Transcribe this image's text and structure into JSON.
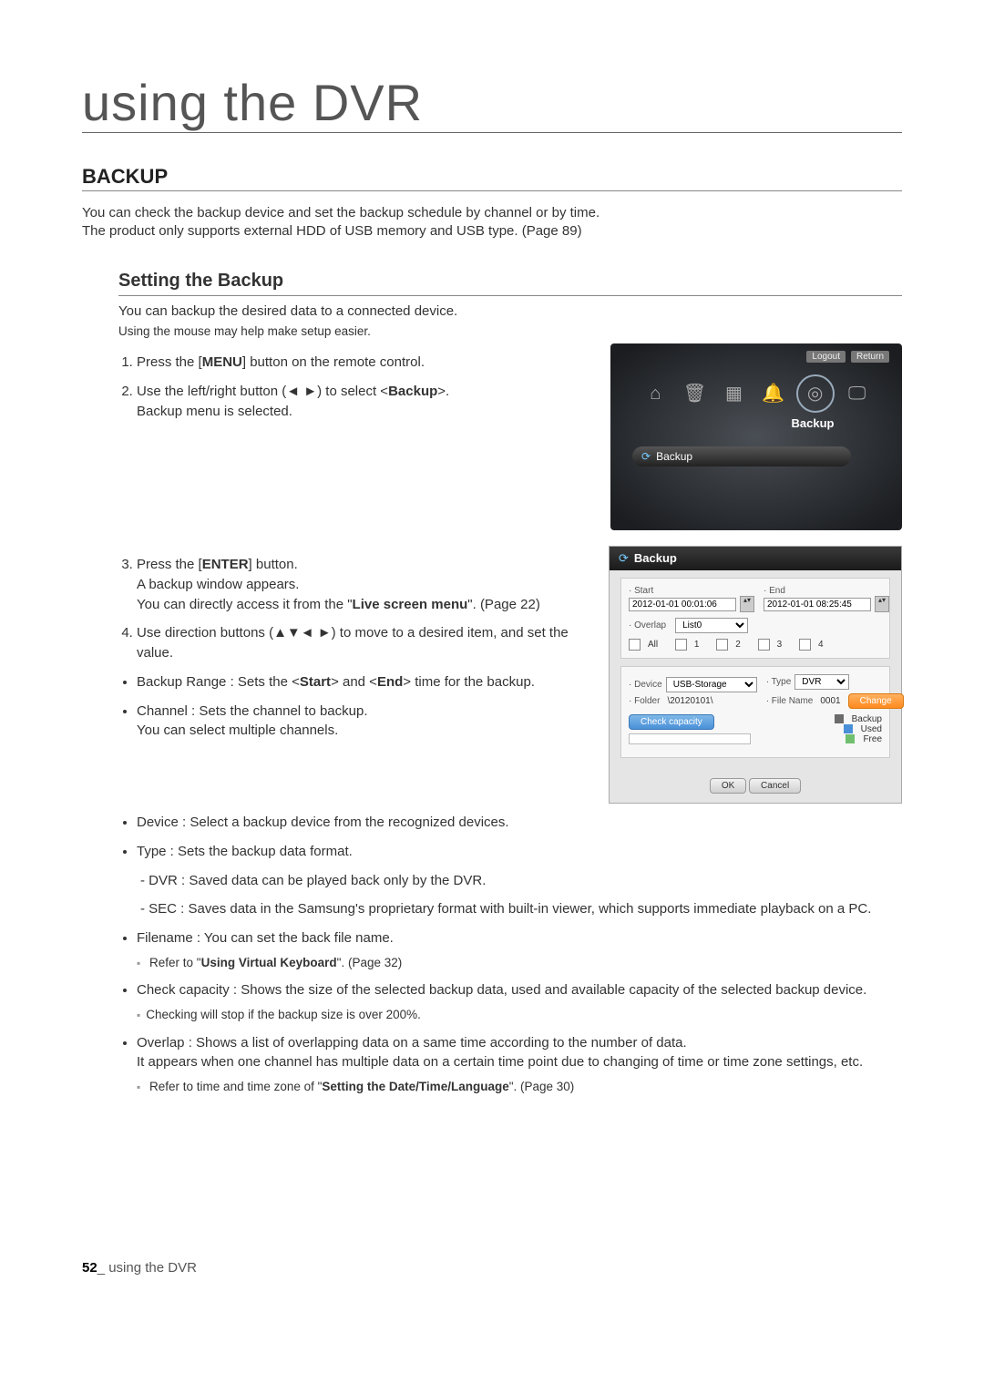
{
  "page_header": "using the DVR",
  "section_title": "BACKUP",
  "intro": {
    "line1": "You can check the backup device and set the backup schedule by channel or by time.",
    "line2": "The product only supports external HDD of USB memory and USB type. (Page 89)"
  },
  "sub_title": "Setting the Backup",
  "lead": "You can backup the desired data to a connected device.",
  "lead_note": "Using the mouse may help make setup easier.",
  "steps12": {
    "s1a": "Press the [",
    "s1b": "MENU",
    "s1c": "] button on the remote control.",
    "s2a": "Use the left/right button (◄ ►) to select <",
    "s2b": "Backup",
    "s2c": ">.",
    "s2d": "Backup menu is selected."
  },
  "fig1": {
    "btn_logout": "Logout",
    "btn_return": "Return",
    "label": "Backup",
    "menuitem": "Backup"
  },
  "steps34": {
    "s3a": "Press the [",
    "s3b": "ENTER",
    "s3c": "] button.",
    "s3d": "A backup window appears.",
    "s3e": "You can directly access it from the \"",
    "s3f": "Live screen menu",
    "s3g": "\". (Page 22)",
    "s4a": "Use direction buttons (▲▼◄ ►) to move to a desired item, and set the value."
  },
  "fig2": {
    "title": "Backup",
    "lbl_start": "· Start",
    "val_start": "2012-01-01 00:01:06",
    "lbl_end": "· End",
    "val_end": "2012-01-01 08:25:45",
    "lbl_overlap": "· Overlap",
    "val_overlap": "List0",
    "chk_all": "All",
    "chk_1": "1",
    "chk_2": "2",
    "chk_3": "3",
    "chk_4": "4",
    "lbl_device": "· Device",
    "val_device": "USB-Storage",
    "lbl_folder": "· Folder",
    "val_folder": "\\20120101\\",
    "lbl_type": "· Type",
    "val_type": "DVR",
    "lbl_filename": "· File Name",
    "val_filename": "0001",
    "btn_change": "Change",
    "btn_check": "Check capacity",
    "leg_backup": "Backup",
    "leg_used": "Used",
    "leg_free": "Free",
    "btn_ok": "OK",
    "btn_cancel": "Cancel"
  },
  "bullets": {
    "b_range_a": "Backup Range : Sets the <",
    "b_range_b": "Start",
    "b_range_c": "> and <",
    "b_range_d": "End",
    "b_range_e": "> time for the backup.",
    "b_channel_a": "Channel : Sets the channel to backup.",
    "b_channel_b": "You can select multiple channels.",
    "b_device": "Device : Select a backup device from the recognized devices.",
    "b_type": "Type : Sets the backup data format.",
    "b_type_dvr": "DVR : Saved data can be played back only by the DVR.",
    "b_type_sec": "SEC : Saves data in the Samsung's proprietary format with built-in viewer, which supports immediate playback on a PC.",
    "b_filename": "Filename : You can set the back file name.",
    "b_filename_note_a": "Refer to \"",
    "b_filename_note_b": "Using Virtual Keyboard",
    "b_filename_note_c": "\". (Page 32)",
    "b_capacity": "Check capacity : Shows the size of the selected backup data, used and available capacity of the selected backup device.",
    "b_capacity_note": "Checking will stop if the backup size is over 200%.",
    "b_overlap_a": "Overlap : Shows a list of overlapping data on a same time according to the number of data.",
    "b_overlap_b": "It appears when one channel has multiple data on a certain time point due to changing of time or time zone settings, etc.",
    "b_overlap_note_a": "Refer to time and time zone of \"",
    "b_overlap_note_b": "Setting the Date/Time/Language",
    "b_overlap_note_c": "\". (Page 30)"
  },
  "footer": {
    "num": "52",
    "sep": "_ ",
    "text": "using the DVR"
  }
}
